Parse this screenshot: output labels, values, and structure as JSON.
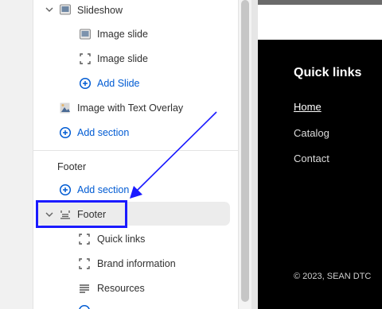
{
  "sidebar": {
    "tree": {
      "slideshow_label": "Slideshow",
      "image_slide_1": "Image slide",
      "image_slide_2": "Image slide",
      "add_slide": "Add Slide",
      "image_text_overlay": "Image with Text Overlay",
      "add_section_1": "Add section"
    },
    "footer_group": {
      "heading": "Footer",
      "add_section": "Add section",
      "footer_label": "Footer",
      "blocks": [
        "Quick links",
        "Brand information",
        "Resources"
      ]
    }
  },
  "preview": {
    "quick_links_heading": "Quick links",
    "links": [
      "Home",
      "Catalog",
      "Contact"
    ],
    "copyright": "© 2023, SEAN DTC"
  },
  "colors": {
    "accent_blue": "#005bd3",
    "annotation_blue": "#1a1aff",
    "preview_bg": "#000000"
  }
}
